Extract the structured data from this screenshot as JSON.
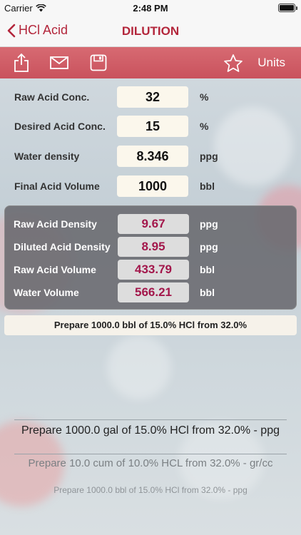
{
  "status": {
    "carrier": "Carrier",
    "time": "2:48 PM"
  },
  "nav": {
    "back_label": "HCl Acid",
    "title": "DILUTION"
  },
  "toolbar": {
    "units_label": "Units"
  },
  "inputs": [
    {
      "label": "Raw Acid Conc.",
      "value": "32",
      "unit": "%"
    },
    {
      "label": "Desired Acid Conc.",
      "value": "15",
      "unit": "%"
    },
    {
      "label": "Water density",
      "value": "8.346",
      "unit": "ppg"
    },
    {
      "label": "Final Acid Volume",
      "value": "1000",
      "unit": "bbl"
    }
  ],
  "results": [
    {
      "label": "Raw Acid Density",
      "value": "9.67",
      "unit": "ppg"
    },
    {
      "label": "Diluted Acid Density",
      "value": "8.95",
      "unit": "ppg"
    },
    {
      "label": "Raw Acid Volume",
      "value": "433.79",
      "unit": "bbl"
    },
    {
      "label": "Water Volume",
      "value": "566.21",
      "unit": "bbl"
    }
  ],
  "summary": "Prepare 1000.0 bbl of 15.0% HCl from 32.0%",
  "picker": {
    "options": [
      "Prepare 1000.0 gal of 15.0% HCl from 32.0% - ppg",
      "Prepare 10.0 cum of 10.0% HCL from 32.0% - gr/cc",
      "Prepare 1000.0 bbl of 15.0% HCl from 32.0% - ppg"
    ]
  },
  "colors": {
    "accent": "#b3263b",
    "toolbar": "#cf5c66",
    "result_value": "#a3174b"
  }
}
